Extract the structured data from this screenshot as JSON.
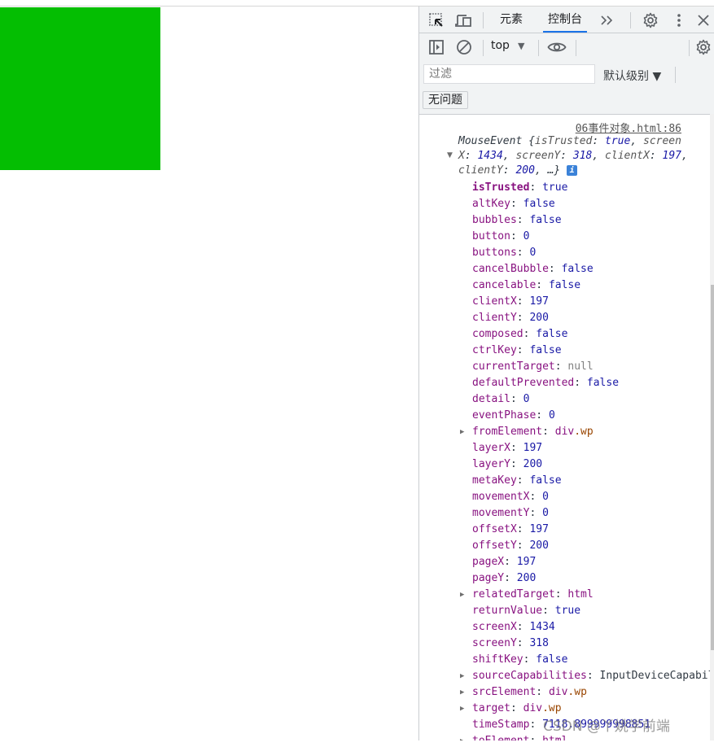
{
  "page": {
    "box_color": "#04BE02"
  },
  "devtools": {
    "tabs": [
      {
        "label": "元素",
        "active": false
      },
      {
        "label": "控制台",
        "active": true
      }
    ],
    "more_tabs": "»",
    "context_select": "top",
    "filter_placeholder": "过滤",
    "level_select": "默认级别 ▼",
    "issues_button": "无问题",
    "accent_color": "#1a73e8"
  },
  "console": {
    "source_link": "06事件对象.html:86",
    "summary": {
      "type": "MouseEvent",
      "preview": [
        {
          "key": "isTrusted",
          "value": "true"
        },
        {
          "key": "screenX",
          "value": "1434"
        },
        {
          "key": "screenY",
          "value": "318"
        },
        {
          "key": "clientX",
          "value": "197"
        },
        {
          "key": "clientY",
          "value": "200"
        }
      ],
      "ellipsis": "…"
    },
    "properties": [
      {
        "name": "isTrusted",
        "value": "true",
        "kind": "bool",
        "bold": true
      },
      {
        "name": "altKey",
        "value": "false",
        "kind": "bool"
      },
      {
        "name": "bubbles",
        "value": "false",
        "kind": "bool"
      },
      {
        "name": "button",
        "value": "0",
        "kind": "num"
      },
      {
        "name": "buttons",
        "value": "0",
        "kind": "num"
      },
      {
        "name": "cancelBubble",
        "value": "false",
        "kind": "bool"
      },
      {
        "name": "cancelable",
        "value": "false",
        "kind": "bool"
      },
      {
        "name": "clientX",
        "value": "197",
        "kind": "num"
      },
      {
        "name": "clientY",
        "value": "200",
        "kind": "num"
      },
      {
        "name": "composed",
        "value": "false",
        "kind": "bool"
      },
      {
        "name": "ctrlKey",
        "value": "false",
        "kind": "bool"
      },
      {
        "name": "currentTarget",
        "value": "null",
        "kind": "null"
      },
      {
        "name": "defaultPrevented",
        "value": "false",
        "kind": "bool"
      },
      {
        "name": "detail",
        "value": "0",
        "kind": "num"
      },
      {
        "name": "eventPhase",
        "value": "0",
        "kind": "num"
      },
      {
        "name": "fromElement",
        "tag": "div",
        "cls": ".wp",
        "kind": "node",
        "expandable": true
      },
      {
        "name": "layerX",
        "value": "197",
        "kind": "num"
      },
      {
        "name": "layerY",
        "value": "200",
        "kind": "num"
      },
      {
        "name": "metaKey",
        "value": "false",
        "kind": "bool"
      },
      {
        "name": "movementX",
        "value": "0",
        "kind": "num"
      },
      {
        "name": "movementY",
        "value": "0",
        "kind": "num"
      },
      {
        "name": "offsetX",
        "value": "197",
        "kind": "num"
      },
      {
        "name": "offsetY",
        "value": "200",
        "kind": "num"
      },
      {
        "name": "pageX",
        "value": "197",
        "kind": "num"
      },
      {
        "name": "pageY",
        "value": "200",
        "kind": "num"
      },
      {
        "name": "relatedTarget",
        "tag": "html",
        "cls": "",
        "kind": "node",
        "expandable": true
      },
      {
        "name": "returnValue",
        "value": "true",
        "kind": "bool"
      },
      {
        "name": "screenX",
        "value": "1434",
        "kind": "num"
      },
      {
        "name": "screenY",
        "value": "318",
        "kind": "num"
      },
      {
        "name": "shiftKey",
        "value": "false",
        "kind": "bool"
      },
      {
        "name": "sourceCapabilities",
        "value": "InputDeviceCapabilities",
        "kind": "plain",
        "expandable": true
      },
      {
        "name": "srcElement",
        "tag": "div",
        "cls": ".wp",
        "kind": "node",
        "expandable": true
      },
      {
        "name": "target",
        "tag": "div",
        "cls": ".wp",
        "kind": "node",
        "expandable": true
      },
      {
        "name": "timeStamp",
        "value": "7118.899999998851",
        "kind": "num"
      },
      {
        "name": "toElement",
        "tag": "html",
        "cls": "",
        "kind": "node",
        "expandable": true
      }
    ]
  },
  "watermark": "CSDN @丫姚学前端"
}
